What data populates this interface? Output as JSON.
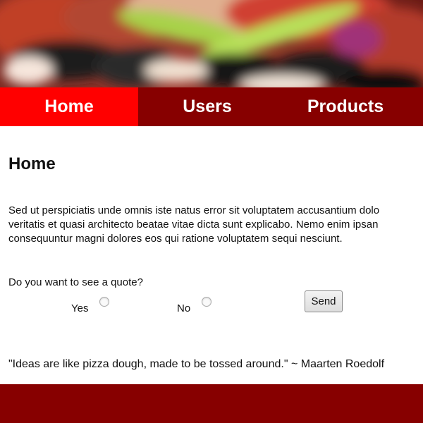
{
  "nav": {
    "items": [
      {
        "label": "Home",
        "active": true
      },
      {
        "label": "Users",
        "active": false
      },
      {
        "label": "Products",
        "active": false
      }
    ]
  },
  "main": {
    "title": "Home",
    "paragraph_lines": [
      "Sed ut perspiciatis unde omnis iste natus error sit voluptatem accusantium dolo",
      "veritatis et quasi architecto beatae vitae dicta sunt explicabo. Nemo enim ipsan",
      "consequuntur magni dolores eos qui ratione voluptatem sequi nesciunt."
    ],
    "quote_question": "Do you want to see a quote?",
    "options": {
      "yes": "Yes",
      "no": "No"
    },
    "send_label": "Send",
    "quote_text": "\"Ideas are like pizza dough, made to be tossed around.\" ~ Maarten Roedolf"
  },
  "colors": {
    "nav_bg": "#870000",
    "nav_active": "#ff0000",
    "footer_bg": "#870000"
  }
}
